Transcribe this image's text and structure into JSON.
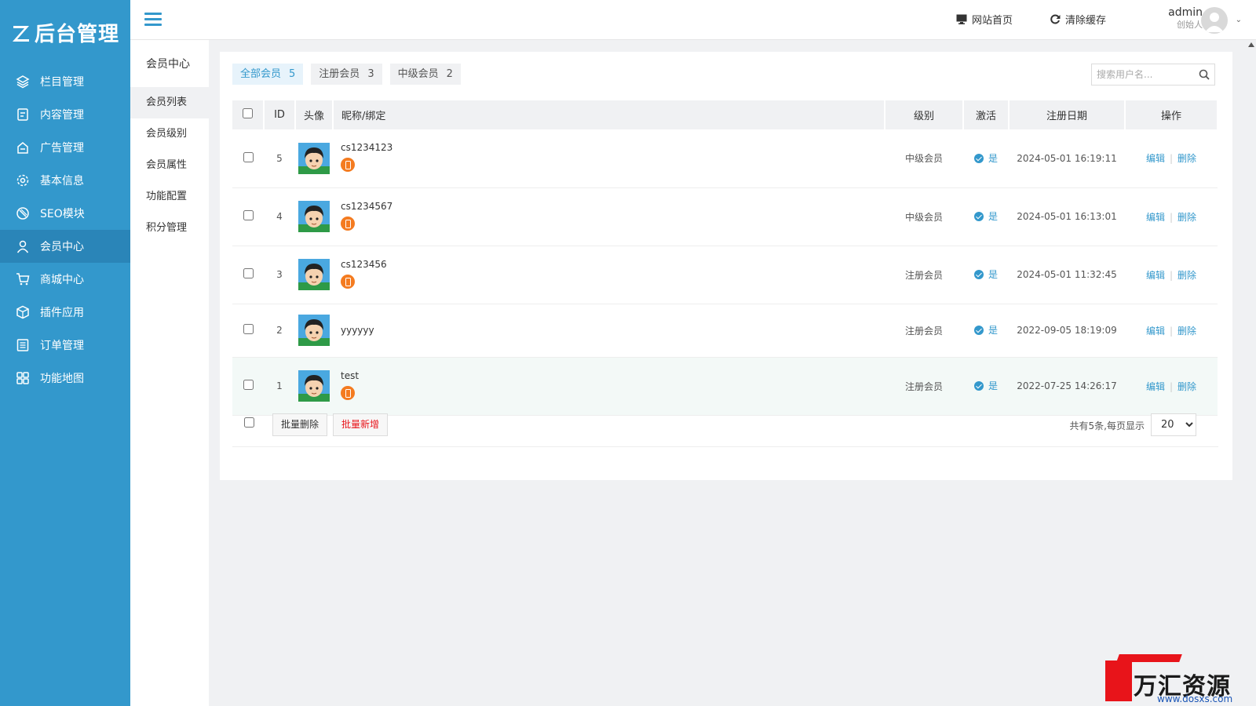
{
  "logo": {
    "text": "后台管理"
  },
  "sidebar": {
    "items": [
      {
        "label": "栏目管理",
        "icon": "layers-icon"
      },
      {
        "label": "内容管理",
        "icon": "document-icon"
      },
      {
        "label": "广告管理",
        "icon": "megaphone-icon"
      },
      {
        "label": "基本信息",
        "icon": "gear-icon"
      },
      {
        "label": "SEO模块",
        "icon": "seo-icon"
      },
      {
        "label": "会员中心",
        "icon": "user-icon",
        "active": true
      },
      {
        "label": "商城中心",
        "icon": "cart-icon"
      },
      {
        "label": "插件应用",
        "icon": "cube-icon"
      },
      {
        "label": "订单管理",
        "icon": "list-icon"
      },
      {
        "label": "功能地图",
        "icon": "grid-icon"
      }
    ]
  },
  "header": {
    "site_home": "网站首页",
    "clear_cache": "清除缓存",
    "user_name": "admin",
    "user_role": "创始人"
  },
  "subside": {
    "title": "会员中心",
    "items": [
      "会员列表",
      "会员级别",
      "会员属性",
      "功能配置",
      "积分管理"
    ]
  },
  "tabs": [
    {
      "label": "全部会员",
      "count": "5"
    },
    {
      "label": "注册会员",
      "count": "3"
    },
    {
      "label": "中级会员",
      "count": "2"
    }
  ],
  "search": {
    "placeholder": "搜索用户名..."
  },
  "table": {
    "headers": {
      "id": "ID",
      "avatar": "头像",
      "nick": "昵称/绑定",
      "level": "级别",
      "active": "激活",
      "date": "注册日期",
      "op": "操作"
    },
    "rows": [
      {
        "id": "5",
        "name": "cs1234123",
        "bind": true,
        "level": "中级会员",
        "active": "是",
        "date": "2024-05-01 16:19:11"
      },
      {
        "id": "4",
        "name": "cs1234567",
        "bind": true,
        "level": "中级会员",
        "active": "是",
        "date": "2024-05-01 16:13:01"
      },
      {
        "id": "3",
        "name": "cs123456",
        "bind": true,
        "level": "注册会员",
        "active": "是",
        "date": "2024-05-01 11:32:45"
      },
      {
        "id": "2",
        "name": "yyyyyy",
        "bind": false,
        "level": "注册会员",
        "active": "是",
        "date": "2022-09-05 18:19:09"
      },
      {
        "id": "1",
        "name": "test",
        "bind": true,
        "level": "注册会员",
        "active": "是",
        "date": "2022-07-25 14:26:17"
      }
    ],
    "edit_label": "编辑",
    "delete_label": "删除"
  },
  "footer": {
    "batch_delete": "批量删除",
    "batch_add": "批量新增",
    "summary": "共有5条,每页显示",
    "page_size": "20"
  },
  "watermark": {
    "text": "万汇资源网",
    "url": "www.dosxs.com"
  },
  "colors": {
    "primary": "#3398cc",
    "bind_orange": "#f47b20",
    "danger": "#e8141a"
  }
}
